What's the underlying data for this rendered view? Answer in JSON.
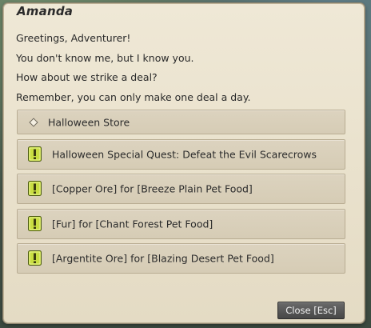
{
  "npc": {
    "name": "Amanda"
  },
  "greeting": [
    "Greetings, Adventurer!",
    "You don't know me, but I know you.",
    "How about we strike a deal?",
    "Remember, you can only make one deal a day."
  ],
  "options": [
    {
      "label": "Halloween Store",
      "icon": "diamond-bullet-icon"
    },
    {
      "label": "Halloween Special Quest: Defeat the Evil Scarecrows",
      "icon": "quest-exclamation-icon"
    },
    {
      "label": "[Copper Ore] for [Breeze Plain Pet Food]",
      "icon": "quest-exclamation-icon"
    },
    {
      "label": "[Fur] for [Chant Forest Pet Food]",
      "icon": "quest-exclamation-icon"
    },
    {
      "label": "[Argentite Ore] for [Blazing Desert Pet Food]",
      "icon": "quest-exclamation-icon"
    }
  ],
  "close_button": {
    "label": "Close [Esc]"
  },
  "colors": {
    "dialog_background": "#ece4d0",
    "option_background": "#d9d0bb",
    "quest_icon_fill": "#c6dc3c",
    "close_button": "#555555"
  }
}
